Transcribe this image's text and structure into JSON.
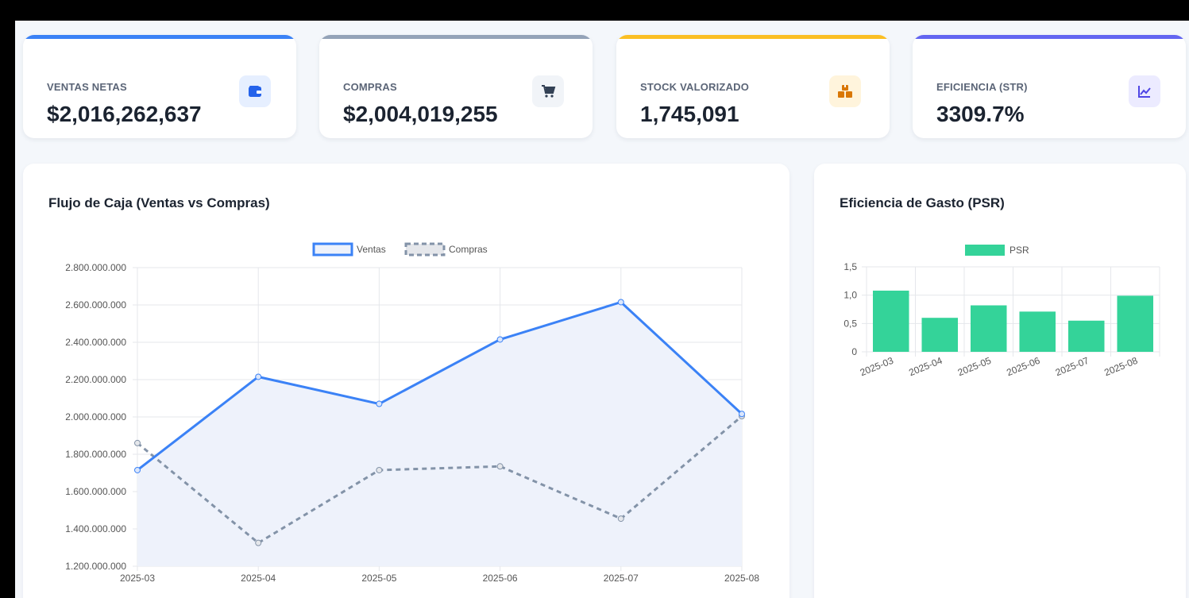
{
  "kpis": [
    {
      "label": "VENTAS NETAS",
      "value": "$2,016,262,637",
      "accent": "#3b82f6",
      "icon": "wallet-icon",
      "icon_color": "#2563eb",
      "icon_bg": "#e6efff"
    },
    {
      "label": "COMPRAS",
      "value": "$2,004,019,255",
      "accent": "#94a3b8",
      "icon": "cart-icon",
      "icon_color": "#334155",
      "icon_bg": "#f1f4f8"
    },
    {
      "label": "STOCK VALORIZADO",
      "value": "1,745,091",
      "accent": "#fbbf24",
      "icon": "boxes-icon",
      "icon_color": "#d97706",
      "icon_bg": "#fff4dc"
    },
    {
      "label": "EFICIENCIA (STR)",
      "value": "3309.7%",
      "accent": "#6366f1",
      "icon": "line-chart-icon",
      "icon_color": "#4f46e5",
      "icon_bg": "#ecebff"
    }
  ],
  "panels": {
    "cashflow_title": "Flujo de Caja (Ventas vs Compras)",
    "psr_title": "Eficiencia de Gasto (PSR)"
  },
  "chart_data": [
    {
      "type": "line",
      "title": "Flujo de Caja (Ventas vs Compras)",
      "x": [
        "2025-03",
        "2025-04",
        "2025-05",
        "2025-06",
        "2025-07",
        "2025-08"
      ],
      "series": [
        {
          "name": "Ventas",
          "values": [
            1715000000,
            2215000000,
            2070000000,
            2415000000,
            2615000000,
            2016000000
          ],
          "color": "#3b82f6",
          "fill": "#eef2fb",
          "style": "solid"
        },
        {
          "name": "Compras",
          "values": [
            1860000000,
            1325000000,
            1715000000,
            1735000000,
            1455000000,
            2004000000
          ],
          "color": "#8393a8",
          "style": "dashed"
        }
      ],
      "ylim": [
        1200000000,
        2800000000
      ],
      "yticks": [
        "2.800.000.000",
        "2.600.000.000",
        "2.400.000.000",
        "2.200.000.000",
        "2.000.000.000",
        "1.800.000.000",
        "1.600.000.000",
        "1.400.000.000",
        "1.200.000.000"
      ],
      "grid": true,
      "legend": "top"
    },
    {
      "type": "bar",
      "title": "Eficiencia de Gasto (PSR)",
      "categories": [
        "2025-03",
        "2025-04",
        "2025-05",
        "2025-06",
        "2025-07",
        "2025-08"
      ],
      "series": [
        {
          "name": "PSR",
          "values": [
            1.08,
            0.6,
            0.82,
            0.71,
            0.55,
            0.99
          ],
          "color": "#34d399"
        }
      ],
      "ylim": [
        0,
        1.5
      ],
      "yticks": [
        "1,5",
        "1,0",
        "0,5",
        "0"
      ],
      "grid": true,
      "legend": "top"
    }
  ]
}
